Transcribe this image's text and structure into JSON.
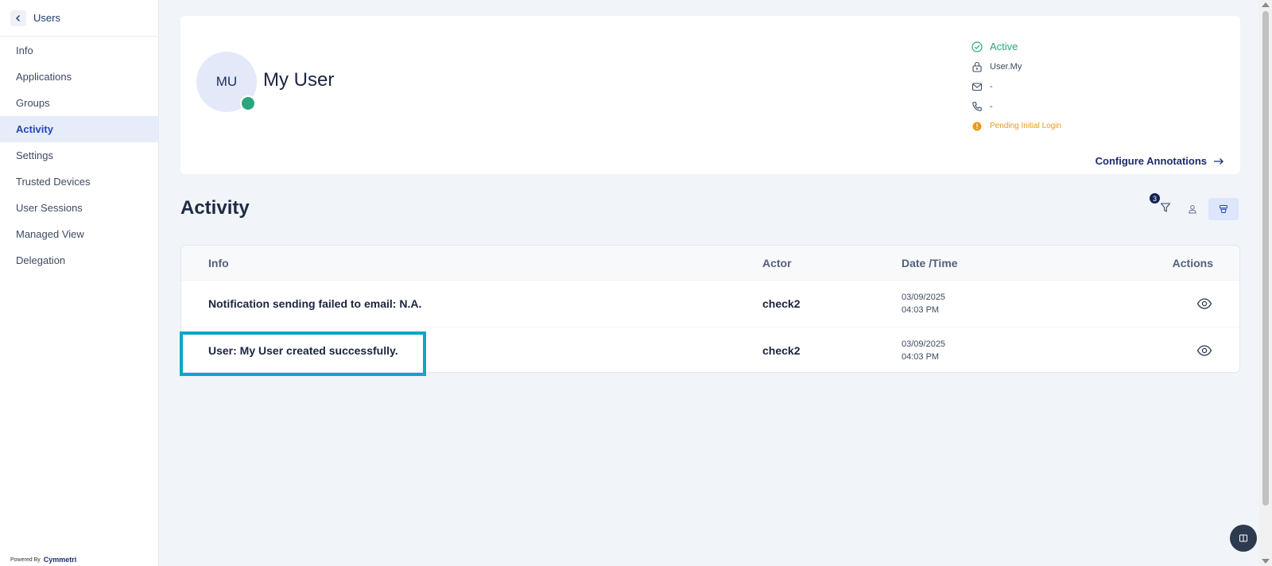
{
  "sidebar": {
    "back_label": "Users",
    "items": [
      {
        "label": "Info",
        "active": false
      },
      {
        "label": "Applications",
        "active": false
      },
      {
        "label": "Groups",
        "active": false
      },
      {
        "label": "Activity",
        "active": true
      },
      {
        "label": "Settings",
        "active": false
      },
      {
        "label": "Trusted Devices",
        "active": false
      },
      {
        "label": "User Sessions",
        "active": false
      },
      {
        "label": "Managed View",
        "active": false
      },
      {
        "label": "Delegation",
        "active": false
      }
    ],
    "powered_by": "Powered By",
    "brand": "Cymmetri"
  },
  "profile": {
    "initials": "MU",
    "name": "My User",
    "status": "Active",
    "username": "User.My",
    "email": "-",
    "phone": "-",
    "login_state": "Pending Initial Login",
    "configure_link": "Configure Annotations"
  },
  "activity": {
    "title": "Activity",
    "filter_count": "3",
    "columns": {
      "info": "Info",
      "actor": "Actor",
      "datetime": "Date /Time",
      "actions": "Actions"
    },
    "rows": [
      {
        "info": "Notification sending failed to email: N.A.",
        "actor": "check2",
        "date": "03/09/2025",
        "time": "04:03 PM"
      },
      {
        "info": "User: My User created successfully.",
        "actor": "check2",
        "date": "03/09/2025",
        "time": "04:03 PM"
      }
    ]
  },
  "colors": {
    "accent": "#2347b6",
    "active_green": "#2aa67f",
    "pending_orange": "#e99a16",
    "highlight": "#0ea5c9"
  }
}
